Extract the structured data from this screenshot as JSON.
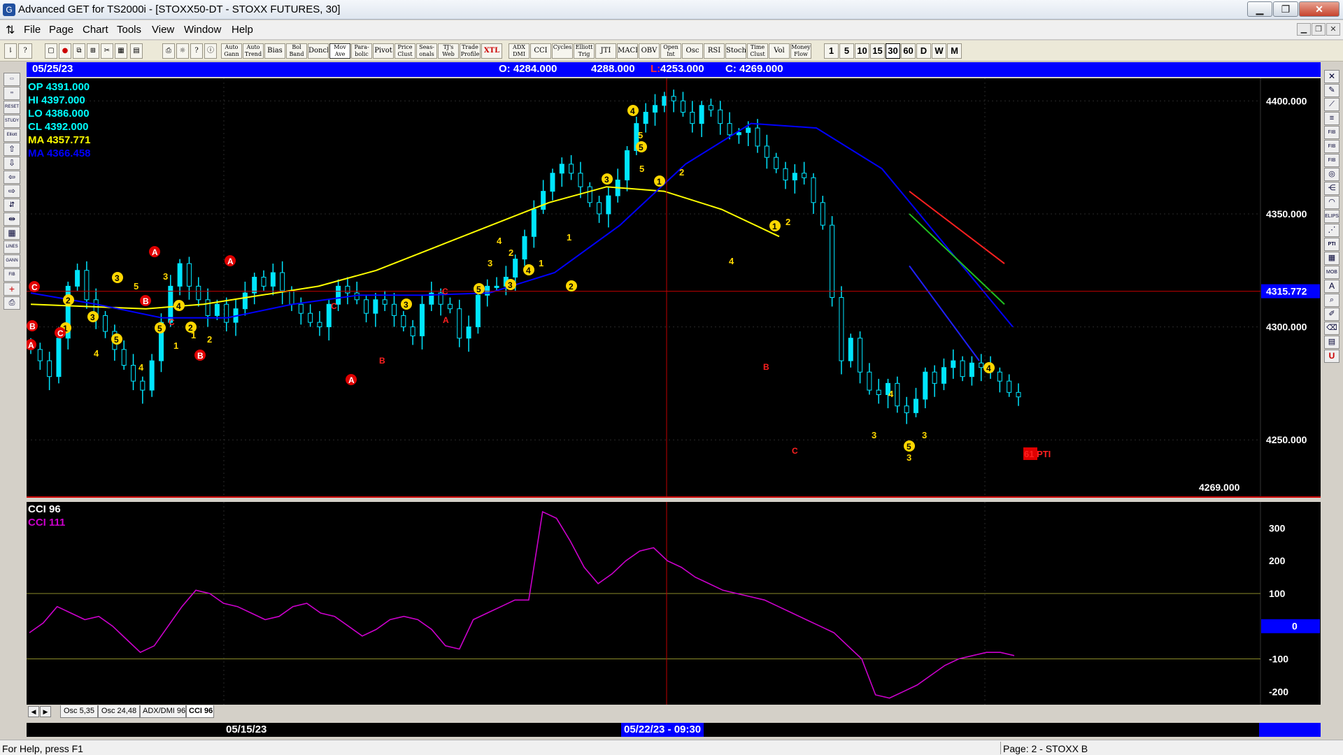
{
  "window": {
    "title": "Advanced GET for TS2000i - [STOXX50-DT - STOXX FUTURES, 30]",
    "minimize": "▁",
    "maximize": "❐",
    "close": "✕"
  },
  "menu": {
    "items": [
      "File",
      "Page",
      "Chart",
      "Tools",
      "View",
      "Window",
      "Help"
    ],
    "mdi": [
      "▁",
      "❐",
      "✕"
    ]
  },
  "toolbar": {
    "study_buttons": [
      {
        "label": "Auto Gann"
      },
      {
        "label": "Auto Trend"
      },
      {
        "label": "Bias"
      },
      {
        "label": "Bol Band"
      },
      {
        "label": "Donch"
      },
      {
        "label": "Mov Ave"
      },
      {
        "label": "Para- bolic"
      },
      {
        "label": "Pivot"
      },
      {
        "label": "Price Clust"
      },
      {
        "label": "Seas- onals"
      },
      {
        "label": "TJ's Web"
      },
      {
        "label": "Trade Profile"
      },
      {
        "label": "XTL"
      }
    ],
    "osc_buttons": [
      {
        "label": "ADX DMI"
      },
      {
        "label": "CCI"
      },
      {
        "label": "Cycles"
      },
      {
        "label": "Elliott Trig"
      },
      {
        "label": "JTI"
      },
      {
        "label": "MACD"
      },
      {
        "label": "OBV"
      },
      {
        "label": "Open Int"
      },
      {
        "label": "Osc"
      },
      {
        "label": "RSI"
      },
      {
        "label": "Stoch"
      },
      {
        "label": "Time Clust"
      },
      {
        "label": "Vol"
      },
      {
        "label": "Money Flow"
      }
    ],
    "intervals": [
      "1",
      "5",
      "10",
      "15",
      "30",
      "60",
      "D",
      "W",
      "M"
    ],
    "active_interval": "30"
  },
  "infobar": {
    "date": "05/25/23",
    "open": "O: 4284.000",
    "high": "4288.000",
    "low_prefix": "L:",
    "low_value": " 4253.000",
    "close": "C: 4269.000"
  },
  "legend": {
    "op": "OP  4391.000",
    "hi": "HI   4397.000",
    "lo": "LO  4386.000",
    "cl": "CL  4392.000",
    "ma1": "MA  4357.771",
    "ma2": "MA  4366.458",
    "colors": {
      "ohlc": "#00ffff",
      "ma1": "#ffff00",
      "ma2": "#0000ff"
    }
  },
  "price_axis": {
    "labels": [
      "4400.000",
      "4350.000",
      "4300.000",
      "4250.000"
    ],
    "cursor_price": "4315.772",
    "last_price": "4269.000"
  },
  "projection_label": "61 PTI",
  "elliott_labels": {
    "yellow": [
      "1",
      "2",
      "3",
      "4",
      "5",
      "3",
      "5",
      "4",
      "5",
      "3",
      "4",
      "1",
      "2",
      "1",
      "2",
      "3",
      "5",
      "3",
      "4",
      "2",
      "3",
      "4",
      "1",
      "2",
      "1",
      "3",
      "4",
      "5",
      "5",
      "5",
      "1",
      "2",
      "4",
      "1",
      "2",
      "3",
      "4",
      "5",
      "3",
      "4",
      "3"
    ],
    "red": [
      "A",
      "B",
      "C",
      "C",
      "B",
      "A",
      "C",
      "B",
      "A",
      "C",
      "A",
      "B",
      "C",
      "A",
      "B",
      "C"
    ]
  },
  "cci": {
    "title": "CCI 96",
    "value_label": "CCI  111",
    "axis_labels": [
      "300",
      "200",
      "100",
      "0",
      "-100",
      "-200"
    ],
    "colors": {
      "title": "#ffffff",
      "line": "#cc00cc"
    }
  },
  "osc_tabs": [
    "Osc 5,35",
    "Osc 24,48",
    "ADX/DMI 96",
    "CCI 96"
  ],
  "date_axis": {
    "left_date": "05/15/23",
    "cursor_datetime": "05/22/23 - 09:30"
  },
  "status": {
    "help": "For Help, press F1",
    "page": "Page: 2 - STOXX B"
  },
  "chart_data": {
    "type": "candlestick",
    "symbol": "STOXX50-DT",
    "interval": "30",
    "ylim": [
      4225,
      4410
    ],
    "close_path": [
      4290,
      4285,
      4278,
      4295,
      4318,
      4325,
      4312,
      4305,
      4298,
      4290,
      4283,
      4276,
      4272,
      4285,
      4302,
      4318,
      4328,
      4318,
      4312,
      4305,
      4310,
      4302,
      4308,
      4315,
      4322,
      4318,
      4324,
      4316,
      4310,
      4306,
      4302,
      4300,
      4310,
      4318,
      4315,
      4312,
      4306,
      4312,
      4310,
      4305,
      4300,
      4296,
      4310,
      4315,
      4310,
      4308,
      4295,
      4300,
      4314,
      4318,
      4318,
      4322,
      4330,
      4340,
      4352,
      4360,
      4368,
      4372,
      4368,
      4362,
      4355,
      4350,
      4358,
      4365,
      4378,
      4390,
      4395,
      4398,
      4402,
      4400,
      4395,
      4390,
      4398,
      4396,
      4390,
      4385,
      4386,
      4388,
      4380,
      4375,
      4370,
      4365,
      4368,
      4366,
      4355,
      4345,
      4313,
      4285,
      4295,
      4280,
      4272,
      4270,
      4275,
      4265,
      4262,
      4268,
      4280,
      4275,
      4282,
      4285,
      4278,
      4284,
      4282,
      4280,
      4276,
      4271,
      4269
    ],
    "ma_yellow": {
      "name": "MA 4357.771",
      "values": [
        4310,
        4309,
        4308,
        4310,
        4314,
        4318,
        4325,
        4335,
        4345,
        4355,
        4362,
        4360,
        4352,
        4340
      ]
    },
    "ma_blue": {
      "name": "MA 4366.458",
      "values": [
        4315,
        4310,
        4304,
        4304,
        4310,
        4314,
        4314,
        4315,
        4324,
        4345,
        4372,
        4390,
        4388,
        4370,
        4335,
        4300
      ]
    },
    "cci": {
      "name": "CCI 96",
      "ylim": [
        -240,
        380
      ],
      "values": [
        -20,
        10,
        60,
        40,
        20,
        30,
        0,
        -40,
        -80,
        -60,
        0,
        60,
        110,
        100,
        70,
        60,
        40,
        20,
        30,
        60,
        70,
        40,
        30,
        0,
        -30,
        -10,
        20,
        30,
        20,
        -10,
        -60,
        -70,
        20,
        40,
        60,
        80,
        80,
        350,
        330,
        260,
        180,
        130,
        160,
        200,
        230,
        240,
        200,
        180,
        150,
        130,
        110,
        100,
        90,
        80,
        60,
        40,
        20,
        0,
        -20,
        -60,
        -100,
        -210,
        -220,
        -200,
        -180,
        -150,
        -120,
        -100,
        -90,
        -80,
        -80,
        -90
      ]
    }
  }
}
